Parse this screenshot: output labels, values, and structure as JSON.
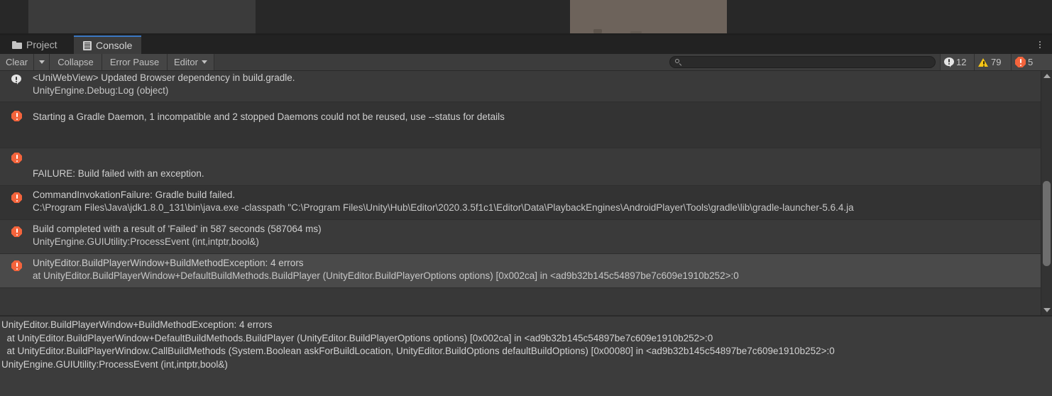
{
  "top_strip": {
    "note": "scene-view remnant above console dock",
    "panel_a_color": "#3b3b3b",
    "panel_b_color": "#6d635b",
    "background": "#282828"
  },
  "tabs": [
    {
      "label": "Project",
      "icon": "folder-icon",
      "active": false
    },
    {
      "label": "Console",
      "icon": "console-icon",
      "active": true
    }
  ],
  "tab_bar": {
    "menu_icon": "kebab-menu-icon",
    "active_accent": "#3b78c3"
  },
  "toolbar": {
    "clear_label": "Clear",
    "clear_dropdown_icon": "chevron-down-icon",
    "collapse_label": "Collapse",
    "error_pause_label": "Error Pause",
    "editor_label": "Editor",
    "editor_dropdown_icon": "chevron-down-icon",
    "search": {
      "icon": "search-icon",
      "value": "",
      "placeholder": ""
    },
    "counters": {
      "info": {
        "count": "12",
        "icon": "info-bubble-icon",
        "color": "#e4e4e4"
      },
      "warning": {
        "count": "79",
        "icon": "warning-triangle-icon",
        "color": "#f5c518"
      },
      "error": {
        "count": "5",
        "icon": "error-octagon-icon",
        "color": "#f4643c"
      }
    }
  },
  "log_rows": [
    {
      "severity": "info",
      "icon": "info-bubble-icon",
      "line1": "<UniWebView> Updated Browser dependency in build.gradle.",
      "line2": "UnityEngine.Debug:Log (object)",
      "selected": false,
      "partial_top": true
    },
    {
      "severity": "error",
      "icon": "error-octagon-icon",
      "line1": "Starting a Gradle Daemon, 1 incompatible and 2 stopped Daemons could not be reused, use --status for details",
      "line2": "",
      "selected": false
    },
    {
      "severity": "error",
      "icon": "error-octagon-icon",
      "line1": "",
      "line2": "FAILURE: Build failed with an exception.",
      "selected": false
    },
    {
      "severity": "error",
      "icon": "error-octagon-icon",
      "line1": "CommandInvokationFailure: Gradle build failed.",
      "line2": "C:\\Program Files\\Java\\jdk1.8.0_131\\bin\\java.exe -classpath \"C:\\Program Files\\Unity\\Hub\\Editor\\2020.3.5f1c1\\Editor\\Data\\PlaybackEngines\\AndroidPlayer\\Tools\\gradle\\lib\\gradle-launcher-5.6.4.ja",
      "selected": false
    },
    {
      "severity": "error",
      "icon": "error-octagon-icon",
      "line1": "Build completed with a result of 'Failed' in 587 seconds (587064 ms)",
      "line2": "UnityEngine.GUIUtility:ProcessEvent (int,intptr,bool&)",
      "selected": false
    },
    {
      "severity": "error",
      "icon": "error-octagon-icon",
      "line1": "UnityEditor.BuildPlayerWindow+BuildMethodException: 4 errors",
      "line2": "  at UnityEditor.BuildPlayerWindow+DefaultBuildMethods.BuildPlayer (UnityEditor.BuildPlayerOptions options) [0x002ca] in <ad9b32b145c54897be7c609e1910b252>:0",
      "selected": true
    }
  ],
  "scrollbar": {
    "up_icon": "scroll-up-arrow-icon",
    "down_icon": "scroll-down-arrow-icon"
  },
  "detail_pane": {
    "lines": [
      "UnityEditor.BuildPlayerWindow+BuildMethodException: 4 errors",
      "  at UnityEditor.BuildPlayerWindow+DefaultBuildMethods.BuildPlayer (UnityEditor.BuildPlayerOptions options) [0x002ca] in <ad9b32b145c54897be7c609e1910b252>:0",
      "  at UnityEditor.BuildPlayerWindow.CallBuildMethods (System.Boolean askForBuildLocation, UnityEditor.BuildOptions defaultBuildOptions) [0x00080] in <ad9b32b145c54897be7c609e1910b252>:0",
      "UnityEngine.GUIUtility:ProcessEvent (int,intptr,bool&)"
    ]
  }
}
